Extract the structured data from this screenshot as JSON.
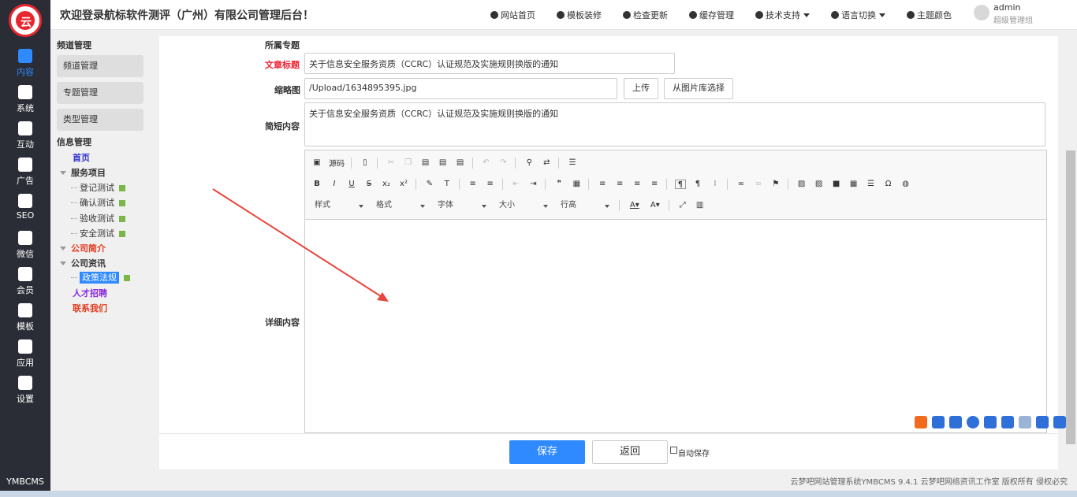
{
  "header": {
    "title": "欢迎登录航标软件测评（广州）有限公司管理后台！",
    "nav": [
      {
        "label": "网站首页",
        "icon": "home-icon",
        "caret": false
      },
      {
        "label": "模板装修",
        "icon": "template-icon",
        "caret": false
      },
      {
        "label": "检查更新",
        "icon": "upload-icon",
        "caret": false
      },
      {
        "label": "缓存管理",
        "icon": "clock-icon",
        "caret": false
      },
      {
        "label": "技术支持",
        "icon": "recycle-icon",
        "caret": true
      },
      {
        "label": "语言切换",
        "icon": "globe-icon",
        "caret": true
      },
      {
        "label": "主题颜色",
        "icon": "palette-icon",
        "caret": false
      }
    ],
    "user": {
      "name": "admin",
      "role": "超级管理组"
    }
  },
  "rail": {
    "logo": "云",
    "items": [
      {
        "label": "内容",
        "icon": "content-icon",
        "active": true
      },
      {
        "label": "系统",
        "icon": "tools-icon",
        "active": false
      },
      {
        "label": "互动",
        "icon": "interact-icon",
        "active": false
      },
      {
        "label": "广告",
        "icon": "ad-icon",
        "active": false
      },
      {
        "label": "SEO",
        "icon": "chart-icon",
        "active": false
      },
      {
        "label": "微信",
        "icon": "wechat-icon",
        "active": false
      },
      {
        "label": "会员",
        "icon": "member-icon",
        "active": false
      },
      {
        "label": "模板",
        "icon": "template-icon",
        "active": false
      },
      {
        "label": "应用",
        "icon": "cube-icon",
        "active": false
      },
      {
        "label": "设置",
        "icon": "settings-icon",
        "active": false
      }
    ],
    "brand": "YMBCMS"
  },
  "sidebar": {
    "channel_title": "频道管理",
    "channel_items": [
      "频道管理",
      "专题管理",
      "类型管理"
    ],
    "info_title": "信息管理",
    "tree": [
      {
        "label": "首页",
        "color": "#3333cc",
        "depth": 0,
        "toggle": false,
        "edit": false
      },
      {
        "label": "服务项目",
        "color": "#333333",
        "depth": 0,
        "toggle": true,
        "edit": false
      },
      {
        "label": "登记测试",
        "color": "#333333",
        "depth": 1,
        "toggle": false,
        "edit": true
      },
      {
        "label": "确认测试",
        "color": "#333333",
        "depth": 1,
        "toggle": false,
        "edit": true
      },
      {
        "label": "验收测试",
        "color": "#333333",
        "depth": 1,
        "toggle": false,
        "edit": true
      },
      {
        "label": "安全测试",
        "color": "#333333",
        "depth": 1,
        "toggle": false,
        "edit": true
      },
      {
        "label": "公司简介",
        "color": "#e23c1e",
        "depth": 0,
        "toggle": true,
        "edit": false
      },
      {
        "label": "公司资讯",
        "color": "#333333",
        "depth": 0,
        "toggle": true,
        "edit": false
      },
      {
        "label": "政策法规",
        "color": "#ffffff",
        "depth": 1,
        "toggle": false,
        "edit": true,
        "selected": true
      },
      {
        "label": "人才招聘",
        "color": "#8a2be2",
        "depth": 0,
        "toggle": false,
        "edit": false
      },
      {
        "label": "联系我们",
        "color": "#e23c1e",
        "depth": 0,
        "toggle": false,
        "edit": false
      }
    ]
  },
  "form": {
    "topic_label": "所属专题",
    "title_label": "文章标题",
    "title_value": "关于信息安全服务资质（CCRC）认证规范及实施规则换版的通知",
    "thumb_label": "缩略图",
    "thumb_value": "/Upload/1634895395.jpg",
    "upload_btn": "上传",
    "gallery_btn": "从图片库选择",
    "summary_label": "简短内容",
    "summary_value": "关于信息安全服务资质（CCRC）认证规范及实施规则换版的通知",
    "detail_label": "详细内容"
  },
  "editor": {
    "source_label": "源码",
    "combos": [
      "样式",
      "格式",
      "字体",
      "大小",
      "行高"
    ]
  },
  "actions": {
    "save": "保存",
    "back": "返回",
    "autosave": "自动保存"
  },
  "footer": "云梦吧网站管理系统YMBCMS 9.4.1   云梦吧网络资讯工作室 版权所有 侵权必究",
  "colors": {
    "accent": "#2f89ff",
    "required": "#e23c1e",
    "rail_bg": "#2a2d36",
    "arrow": "#e8463e"
  }
}
